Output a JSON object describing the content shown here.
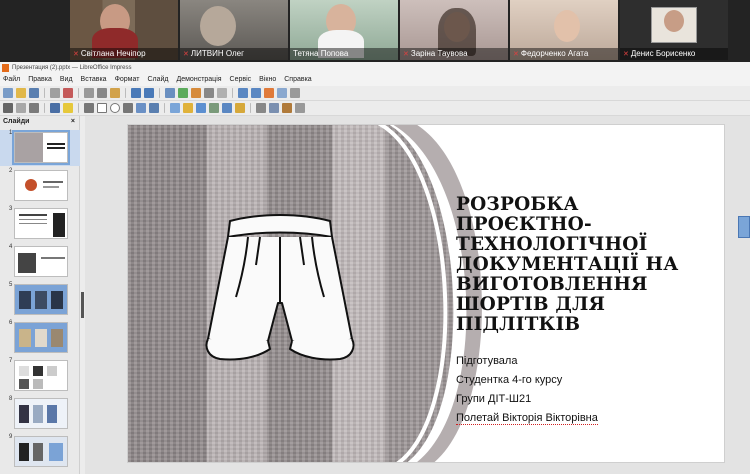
{
  "participants": [
    {
      "name": "Світлана Нечіпор",
      "muted": true
    },
    {
      "name": "ЛИТВИН Олег",
      "muted": true
    },
    {
      "name": "Тетяна Попова",
      "muted": false
    },
    {
      "name": "Заріна Таувова",
      "muted": true
    },
    {
      "name": "Федорченко Агата",
      "muted": true
    },
    {
      "name": "Денис Борисенко",
      "muted": true
    }
  ],
  "window": {
    "title": "Презентация (2).pptx — LibreOffice Impress"
  },
  "menu": [
    "Файл",
    "Правка",
    "Вид",
    "Вставка",
    "Формат",
    "Слайд",
    "Демонстрація",
    "Сервіс",
    "Вікно",
    "Справка"
  ],
  "slides_pane": {
    "header": "Слайди",
    "close": "×",
    "numbers": [
      "1",
      "2",
      "3",
      "4",
      "5",
      "6",
      "7",
      "8",
      "9"
    ]
  },
  "slide": {
    "title": "РОЗРОБКА ПРОЄКТНО-ТЕХНОЛОГІЧНОЇ ДОКУМЕНТАЦІЇ НА ВИГОТОВЛЕННЯ ШОРТІВ ДЛЯ ПІДЛІТКІВ",
    "prepared": "Підготувала",
    "student": "Студентка 4-го курсу",
    "group": "Групи ДІТ-Ш21",
    "author": "Полетай Вікторія Вікторівна"
  }
}
